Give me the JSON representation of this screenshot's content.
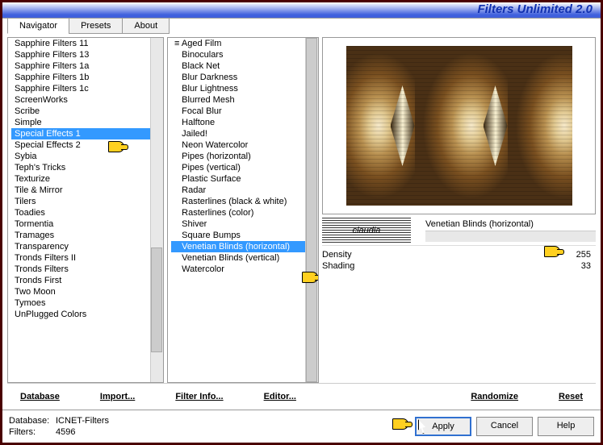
{
  "title": "Filters Unlimited 2.0",
  "tabs": [
    "Navigator",
    "Presets",
    "About"
  ],
  "activeTab": 0,
  "categories": [
    "Sapphire Filters 11",
    "Sapphire Filters 13",
    "Sapphire Filters 1a",
    "Sapphire Filters 1b",
    "Sapphire Filters 1c",
    "ScreenWorks",
    "Scribe",
    "Simple",
    "Special Effects 1",
    "Special Effects 2",
    "Sybia",
    "Teph's Tricks",
    "Texturize",
    "Tile & Mirror",
    "Tilers",
    "Toadies",
    "Tormentia",
    "Tramages",
    "Transparency",
    "Tronds Filters II",
    "Tronds Filters",
    "Tronds First",
    "Two Moon",
    "Tymoes",
    "UnPlugged Colors"
  ],
  "selectedCategoryIndex": 8,
  "catPrefix": "≡ ",
  "filters": [
    "Aged Film",
    "Binoculars",
    "Black Net",
    "Blur Darkness",
    "Blur Lightness",
    "Blurred Mesh",
    "Focal Blur",
    "Halftone",
    "Jailed!",
    "Neon Watercolor",
    "Pipes (horizontal)",
    "Pipes (vertical)",
    "Plastic Surface",
    "Radar",
    "Rasterlines (black & white)",
    "Rasterlines (color)",
    "Shiver",
    "Square Bumps",
    "Venetian Blinds (horizontal)",
    "Venetian Blinds (vertical)",
    "Watercolor"
  ],
  "selectedFilterIndex": 18,
  "watermark": "claudia",
  "filterName": "Venetian Blinds (horizontal)",
  "params": [
    {
      "label": "Density",
      "value": 255
    },
    {
      "label": "Shading",
      "value": 33
    }
  ],
  "buttons1": {
    "database": "Database",
    "import": "Import...",
    "filterInfo": "Filter Info...",
    "editor": "Editor...",
    "randomize": "Randomize",
    "reset": "Reset"
  },
  "status": {
    "dbLabel": "Database:",
    "db": "ICNET-Filters",
    "filterLabel": "Filters:",
    "filterCount": "4596"
  },
  "footerBtns": {
    "apply": "Apply",
    "cancel": "Cancel",
    "help": "Help"
  }
}
